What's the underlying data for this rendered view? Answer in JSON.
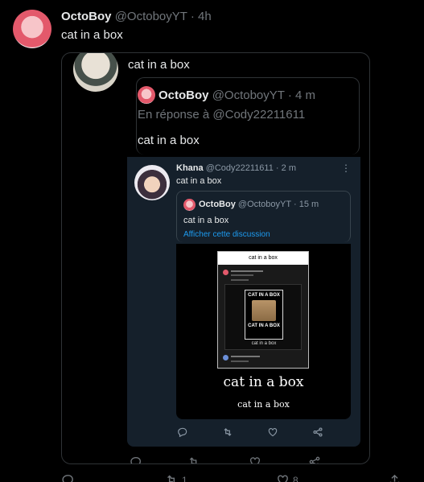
{
  "tweet": {
    "name": "OctoBoy",
    "handle": "@OctoboyYT",
    "time": "4h",
    "text": "cat in a box",
    "stats": {
      "retweets": "1",
      "likes": "8"
    }
  },
  "embed": {
    "top_text": "cat in a box",
    "reply": {
      "name": "OctoBoy",
      "handle": "@OctoboyYT",
      "time": "4 m",
      "in_reply_prefix": "En réponse à ",
      "in_reply_handle": "@Cody22211611",
      "text": "cat in a box"
    },
    "dark": {
      "name": "Khana",
      "handle": "@Cody22211611",
      "time": "2 m",
      "text": "cat in a box",
      "quote": {
        "name": "OctoBoy",
        "handle": "@OctoboyYT",
        "time": "15 m",
        "text": "cat in a box",
        "show_thread": "Afficher cette discussion"
      },
      "meme": {
        "box_label": "cat in a box",
        "badge_top": "CAT IN A BOX",
        "badge_bottom": "CAT IN A BOX",
        "caption_small": "cat in a box",
        "caption_large": "cat in a box",
        "caption_medium": "cat in a box"
      }
    }
  },
  "colors": {
    "background": "#000000",
    "dark_card": "#15202b",
    "accent": "#1d9bf0",
    "muted": "#71767b"
  }
}
